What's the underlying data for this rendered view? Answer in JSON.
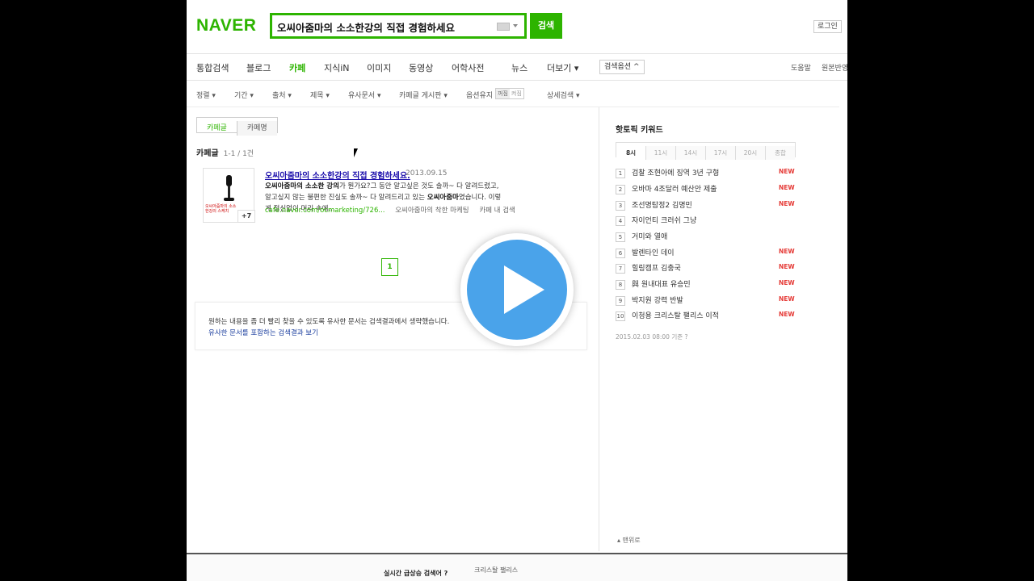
{
  "header": {
    "logo": "NAVER",
    "query": "오씨아줌마의 소소한강의 직접 경험하세요",
    "search_button": "검색",
    "login_button": "로그인"
  },
  "tabs": [
    {
      "label": "통합검색",
      "active": false
    },
    {
      "label": "블로그",
      "active": false
    },
    {
      "label": "카페",
      "active": true
    },
    {
      "label": "지식iN",
      "active": false
    },
    {
      "label": "이미지",
      "active": false
    },
    {
      "label": "동영상",
      "active": false
    },
    {
      "label": "어학사전",
      "active": false
    },
    {
      "label": "뉴스",
      "active": false
    },
    {
      "label": "더보기 ▾",
      "active": false
    }
  ],
  "search_options_button": "검색옵션 ^",
  "tab_right": {
    "help": "도움말",
    "feedback": "원본반영"
  },
  "filters": [
    "정렬 ▾",
    "기간 ▾",
    "출처 ▾",
    "제목 ▾",
    "유사문서 ▾",
    "카페글 게시판 ▾",
    "옵션유지",
    "상세검색 ▾"
  ],
  "option_toggle": {
    "on": "꺼짐",
    "off": "켜짐"
  },
  "segment": {
    "cafe_posts": "카페글",
    "cafe_names": "카페명"
  },
  "section": {
    "label": "카페글",
    "count": "1-1 / 1건"
  },
  "result": {
    "title": "오씨아줌마의 소소한강의 직접 경험하세요.",
    "date": "2013.09.15",
    "desc_bold1": "오씨아줌마의 소소한 강의",
    "desc_text1": "가 뭔가요?그 동안 알고싶은 것도 솔까~ 다 알려드렸고, 알고싶지 않는 불편한 진실도 솔까~ 다 알려드리고 있는 ",
    "desc_bold2": "오씨아줌마",
    "desc_text2": "였습니다. 이렇게 정신없이 머리 속에...",
    "url": "cafe.naver.com/ocmarketing/726...",
    "cafe_name": "오씨아줌마의 착한 마케팅",
    "in_cafe_search": "카페 내 검색",
    "thumb_caption": "오씨아줌마의 소소한강의 스케치",
    "thumb_count": "+7"
  },
  "pagination": {
    "current": "1"
  },
  "notice": {
    "line1": "원하는 내용을 좀 더 빨리 찾을 수 있도록 유사한 문서는 검색결과에서 생략했습니다.",
    "line2": "유사한 문서를 포함하는 검색결과 보기"
  },
  "sidebar": {
    "title": "핫토픽 키워드",
    "time_tabs": [
      "8시",
      "11시",
      "14시",
      "17시",
      "20시",
      "종합"
    ],
    "keywords": [
      {
        "rank": "1",
        "text": "검찰 조현아에 징역 3년 구형",
        "badge": "NEW"
      },
      {
        "rank": "2",
        "text": "오바마 4조달러 예산안 제출",
        "badge": "NEW"
      },
      {
        "rank": "3",
        "text": "조선명탐정2 김명민",
        "badge": "NEW"
      },
      {
        "rank": "4",
        "text": "자이언티 크러쉬 그냥",
        "badge": ""
      },
      {
        "rank": "5",
        "text": "거미와 열애",
        "badge": ""
      },
      {
        "rank": "6",
        "text": "발렌타인 데이",
        "badge": "NEW"
      },
      {
        "rank": "7",
        "text": "힐링캠프 김충국",
        "badge": "NEW"
      },
      {
        "rank": "8",
        "text": "與 원내대표 유승민",
        "badge": "NEW"
      },
      {
        "rank": "9",
        "text": "박지원 강력 반발",
        "badge": "NEW"
      },
      {
        "rank": "10",
        "text": "이청용 크리스탈 팰리스 이적",
        "badge": "NEW"
      }
    ],
    "timestamp": "2015.02.03 08:00 기준 ?"
  },
  "to_top": "▴ 맨위로",
  "footer": {
    "title": "실시간 급상승 검색어 ?",
    "item": "크리스탈 팰리스"
  },
  "colors": {
    "accent": "#2db400",
    "link": "#1a0dab",
    "new_badge": "#e53935",
    "play": "#4aa3ea"
  }
}
